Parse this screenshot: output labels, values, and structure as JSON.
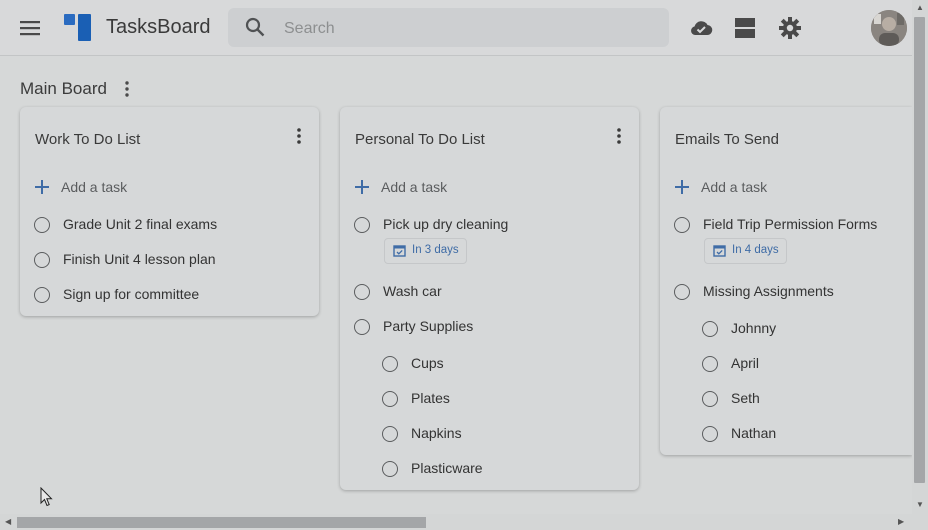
{
  "header": {
    "app_title": "TasksBoard",
    "search_placeholder": "Search",
    "icons": [
      "menu-icon",
      "tasksboard-logo",
      "search-icon",
      "cloud-done-icon",
      "view-agenda-icon",
      "settings-icon",
      "avatar"
    ]
  },
  "board": {
    "title": "Main Board"
  },
  "lists": [
    {
      "title": "Work To Do List",
      "add_label": "Add a task",
      "tasks": [
        {
          "text": "Grade Unit 2 final exams"
        },
        {
          "text": "Finish Unit 4 lesson plan"
        },
        {
          "text": "Sign up for committee"
        }
      ]
    },
    {
      "title": "Personal To Do List",
      "add_label": "Add a task",
      "tasks": [
        {
          "text": "Pick up dry cleaning",
          "due": "In 3 days"
        },
        {
          "text": "Wash car"
        },
        {
          "text": "Party Supplies",
          "subtasks": [
            "Cups",
            "Plates",
            "Napkins",
            "Plasticware"
          ]
        }
      ]
    },
    {
      "title": "Emails To Send",
      "add_label": "Add a task",
      "tasks": [
        {
          "text": "Field Trip Permission Forms",
          "due": "In 4 days"
        },
        {
          "text": "Missing Assignments",
          "subtasks": [
            "Johnny",
            "April",
            "Seth",
            "Nathan"
          ]
        }
      ]
    }
  ],
  "colors": {
    "accent_blue": "#3f6ca6",
    "logo_blue": "#1a5fb4",
    "overlay_bg": "#d6d8d8"
  }
}
